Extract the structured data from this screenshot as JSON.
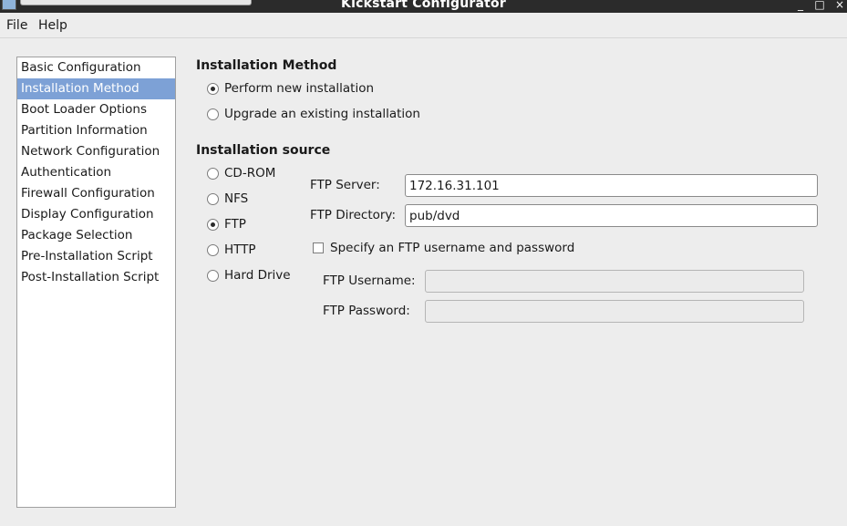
{
  "window": {
    "title": "Kickstart Configurator",
    "controls": {
      "minimize": "_",
      "maximize": "□",
      "close": "×"
    }
  },
  "menu": {
    "file": "File",
    "help": "Help"
  },
  "sidebar": {
    "items": [
      {
        "label": "Basic Configuration",
        "selected": false
      },
      {
        "label": "Installation Method",
        "selected": true
      },
      {
        "label": "Boot Loader Options",
        "selected": false
      },
      {
        "label": "Partition Information",
        "selected": false
      },
      {
        "label": "Network Configuration",
        "selected": false
      },
      {
        "label": "Authentication",
        "selected": false
      },
      {
        "label": "Firewall Configuration",
        "selected": false
      },
      {
        "label": "Display Configuration",
        "selected": false
      },
      {
        "label": "Package Selection",
        "selected": false
      },
      {
        "label": "Pre-Installation Script",
        "selected": false
      },
      {
        "label": "Post-Installation Script",
        "selected": false
      }
    ]
  },
  "install_method": {
    "heading": "Installation Method",
    "options": [
      {
        "label": "Perform new installation",
        "checked": true
      },
      {
        "label": "Upgrade an existing installation",
        "checked": false
      }
    ]
  },
  "install_source": {
    "heading": "Installation source",
    "options": [
      {
        "label": "CD-ROM",
        "checked": false
      },
      {
        "label": "NFS",
        "checked": false
      },
      {
        "label": "FTP",
        "checked": true
      },
      {
        "label": "HTTP",
        "checked": false
      },
      {
        "label": "Hard Drive",
        "checked": false
      }
    ]
  },
  "ftp": {
    "server_label": "FTP Server:",
    "server_value": "172.16.31.101",
    "directory_label": "FTP Directory:",
    "directory_value": "pub/dvd",
    "auth_checkbox_label": "Specify an FTP username and password",
    "auth_checked": false,
    "username_label": "FTP Username:",
    "username_value": "",
    "password_label": "FTP Password:",
    "password_value": ""
  }
}
